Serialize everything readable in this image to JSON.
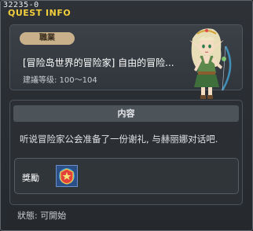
{
  "window": {
    "quest_id": "32235-0",
    "title": "QUEST INFO"
  },
  "header": {
    "job_tag": "職業",
    "quest_name": "[冒险岛世界的冒险家] 自由的冒险...",
    "level_label": "建議等级: 100～104"
  },
  "content": {
    "header_label": "内容",
    "text": "听说冒险家公会准备了一份谢礼, 与赫丽娜对话吧.",
    "reward_label": "獎勵"
  },
  "status": {
    "text": "狀態:  可開始"
  },
  "colors": {
    "title": "#f3cf3b",
    "job_tag_bg": "#c8b08a",
    "panel_bg": "#2b2f34"
  },
  "icons": {
    "npc": "elf-archer-npc-portrait",
    "reward": "reward-item-icon"
  }
}
